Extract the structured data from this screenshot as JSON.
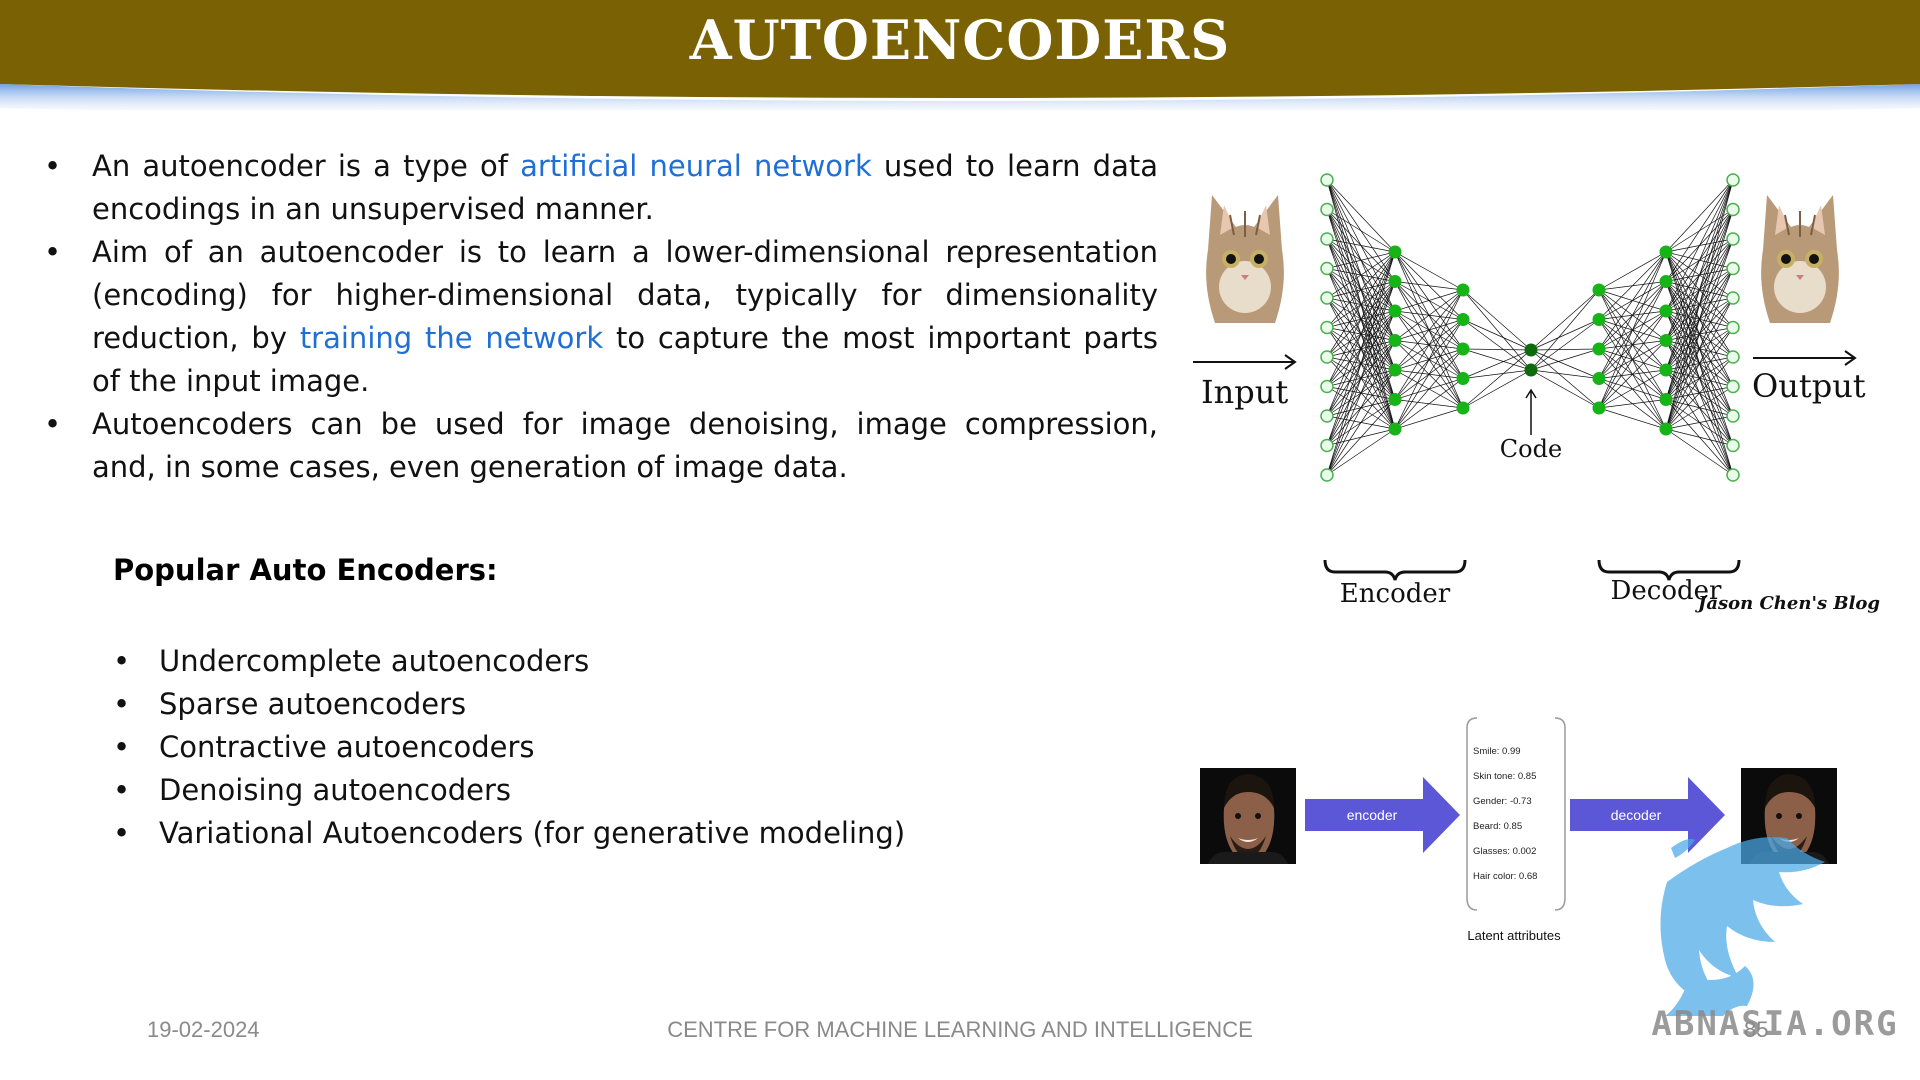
{
  "header": {
    "title": "AUTOENCODERS",
    "band_color": "#7a6104"
  },
  "bullets": [
    {
      "before": "An autoencoder is a type of ",
      "link": "artificial neural network",
      "after": " used to learn data encodings in an unsupervised manner."
    },
    {
      "before": "Aim of an autoencoder is to learn a lower-dimensional representation (encoding) for higher-dimensional data, typically for dimensionality reduction, by ",
      "link": "training the network",
      "after": " to capture the most important parts of the input image."
    },
    {
      "text": "Autoencoders can be used for image denoising, image compression, and, in some cases, even generation of image data."
    }
  ],
  "popular": {
    "title": "Popular Auto Encoders:",
    "items": [
      "Undercomplete autoencoders",
      "Sparse autoencoders",
      "Contractive autoencoders",
      "Denoising autoencoders",
      "Variational Autoencoders (for generative modeling)"
    ]
  },
  "ae_diagram": {
    "input_label": "Input",
    "output_label": "Output",
    "code_label": "Code",
    "encoder_label": "Encoder",
    "decoder_label": "Decoder",
    "credit": "Jason Chen's Blog",
    "node_color": "#16b416",
    "input_icon": "cat-photo",
    "output_icon": "cat-photo"
  },
  "latent_diagram": {
    "encoder_label": "encoder",
    "decoder_label": "decoder",
    "arrow_color": "#5b57d6",
    "attributes": [
      "Smile: 0.99",
      "Skin tone: 0.85",
      "Gender: -0.73",
      "Beard: 0.85",
      "Glasses: 0.002",
      "Hair color: 0.68"
    ],
    "caption": "Latent attributes",
    "input_icon": "face-photo",
    "output_icon": "face-photo"
  },
  "footer": {
    "date": "19-02-2024",
    "center": "CENTRE FOR MACHINE LEARNING AND INTELLIGENCE",
    "page": "85"
  },
  "watermark": {
    "text": "ABNASIA.ORG",
    "icon": "griffin-logo"
  }
}
